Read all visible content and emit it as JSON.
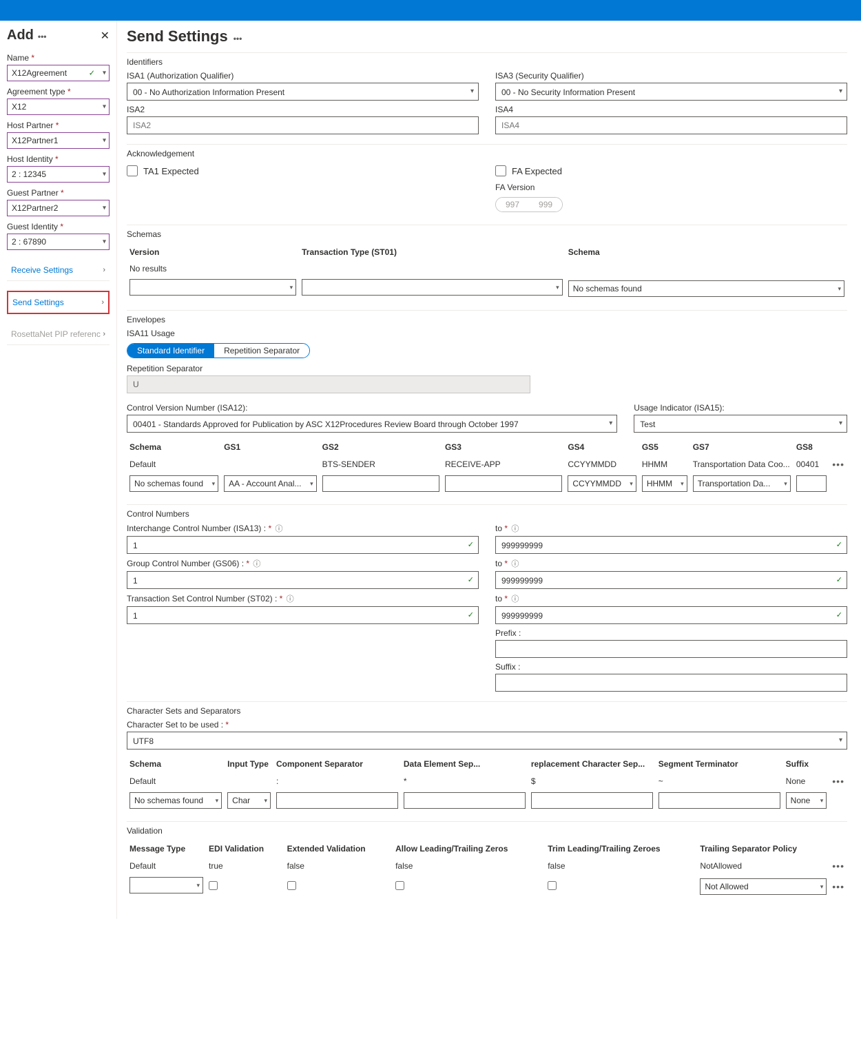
{
  "sidebar": {
    "title": "Add",
    "fields": {
      "name": {
        "label": "Name",
        "value": "X12Agreement"
      },
      "agreementType": {
        "label": "Agreement type",
        "value": "X12"
      },
      "hostPartner": {
        "label": "Host Partner",
        "value": "X12Partner1"
      },
      "hostIdentity": {
        "label": "Host Identity",
        "value": "2 : 12345"
      },
      "guestPartner": {
        "label": "Guest Partner",
        "value": "X12Partner2"
      },
      "guestIdentity": {
        "label": "Guest Identity",
        "value": "2 : 67890"
      }
    },
    "nav": {
      "receive": "Receive Settings",
      "send": "Send Settings",
      "rosetta": "RosettaNet PIP referenc"
    }
  },
  "page": {
    "title": "Send Settings",
    "identifiers": {
      "section": "Identifiers",
      "isa1": {
        "label": "ISA1 (Authorization Qualifier)",
        "value": "00 - No Authorization Information Present"
      },
      "isa3": {
        "label": "ISA3 (Security Qualifier)",
        "value": "00 - No Security Information Present"
      },
      "isa2": {
        "label": "ISA2",
        "placeholder": "ISA2"
      },
      "isa4": {
        "label": "ISA4",
        "placeholder": "ISA4"
      }
    },
    "ack": {
      "section": "Acknowledgement",
      "ta1": "TA1 Expected",
      "fa": "FA Expected",
      "faVersion": "FA Version",
      "faOptions": {
        "a": "997",
        "b": "999"
      }
    },
    "schemas": {
      "section": "Schemas",
      "headers": {
        "version": "Version",
        "tt": "Transaction Type (ST01)",
        "schema": "Schema"
      },
      "noResults": "No results",
      "noSchemas": "No schemas found"
    },
    "envelopes": {
      "section": "Envelopes",
      "isa11": "ISA11 Usage",
      "std": "Standard Identifier",
      "rep": "Repetition Separator",
      "repLabel": "Repetition Separator",
      "repValue": "U",
      "cvn": {
        "label": "Control Version Number (ISA12):",
        "value": "00401 - Standards Approved for Publication by ASC X12Procedures Review Board through October 1997"
      },
      "usage": {
        "label": "Usage Indicator (ISA15):",
        "value": "Test"
      },
      "cols": {
        "schema": "Schema",
        "gs1": "GS1",
        "gs2": "GS2",
        "gs3": "GS3",
        "gs4": "GS4",
        "gs5": "GS5",
        "gs7": "GS7",
        "gs8": "GS8"
      },
      "defaultRow": {
        "schema": "Default",
        "gs2": "BTS-SENDER",
        "gs3": "RECEIVE-APP",
        "gs4": "CCYYMMDD",
        "gs5": "HHMM",
        "gs7": "Transportation Data Coo...",
        "gs8": "00401"
      },
      "inputRow": {
        "schema": "No schemas found",
        "gs1": "AA - Account Anal...",
        "gs4": "CCYYMMDD",
        "gs5": "HHMM",
        "gs7": "Transportation Da..."
      }
    },
    "controlNumbers": {
      "section": "Control Numbers",
      "rows": {
        "icn": "Interchange Control Number (ISA13) :",
        "gcn": "Group Control Number (GS06) :",
        "tsc": "Transaction Set Control Number (ST02) :"
      },
      "to": "to",
      "from": "1",
      "toVal": "999999999",
      "prefix": "Prefix :",
      "suffix": "Suffix :"
    },
    "charset": {
      "section": "Character Sets and Separators",
      "label": "Character Set to be used :",
      "value": "UTF8",
      "cols": {
        "schema": "Schema",
        "inputType": "Input Type",
        "comp": "Component Separator",
        "data": "Data Element Sep...",
        "repl": "replacement Character Sep...",
        "seg": "Segment Terminator",
        "suffix": "Suffix"
      },
      "defaultRow": {
        "schema": "Default",
        "comp": ":",
        "data": "*",
        "repl": "$",
        "seg": "~",
        "suffix": "None"
      },
      "inputRow": {
        "schema": "No schemas found",
        "inputType": "Char",
        "suffix": "None"
      }
    },
    "validation": {
      "section": "Validation",
      "cols": {
        "msg": "Message Type",
        "edi": "EDI Validation",
        "ext": "Extended Validation",
        "lead": "Allow Leading/Trailing Zeros",
        "trim": "Trim Leading/Trailing Zeroes",
        "trail": "Trailing Separator Policy"
      },
      "defaultRow": {
        "msg": "Default",
        "edi": "true",
        "ext": "false",
        "lead": "false",
        "trim": "false",
        "trail": "NotAllowed"
      },
      "inputRow": {
        "trail": "Not Allowed"
      }
    }
  }
}
